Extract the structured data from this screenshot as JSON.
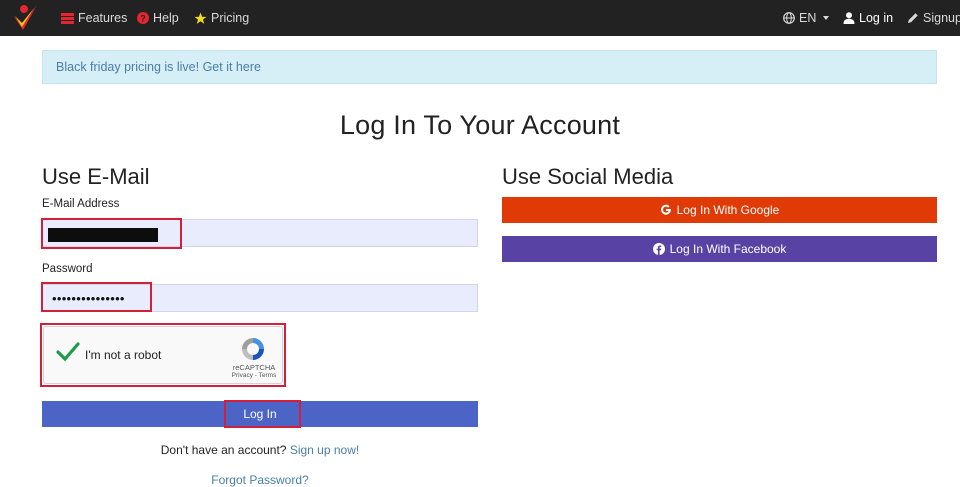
{
  "nav": {
    "left": [
      {
        "label": "Features",
        "icon": "list-icon"
      },
      {
        "label": "Help",
        "icon": "question-circle-icon"
      },
      {
        "label": "Pricing",
        "icon": "star-icon"
      }
    ],
    "language": "EN",
    "login": "Log in",
    "signup": "Signup"
  },
  "alert": {
    "text": "Black friday pricing is live! Get it here"
  },
  "page": {
    "title": "Log In To Your Account"
  },
  "email_section": {
    "heading": "Use E-Mail",
    "email_label": "E-Mail Address",
    "email_value": "",
    "password_label": "Password",
    "password_value": "•••••••••••••••"
  },
  "captcha": {
    "label": "I'm not a robot",
    "brand": "reCAPTCHA",
    "links": "Privacy - Terms"
  },
  "login_button": "Log In",
  "signup_prompt": {
    "text": "Don't have an account?",
    "link": "Sign up now!"
  },
  "forgot": "Forgot Password?",
  "social": {
    "heading": "Use Social Media",
    "google": "Log In With Google",
    "facebook": "Log In With Facebook"
  },
  "colors": {
    "navbar": "#222222",
    "alert_bg": "#d6eef6",
    "link": "#4a7fa6",
    "primary": "#4c64c5",
    "google": "#e03a06",
    "facebook": "#5843a5",
    "annotation": "#d3203a"
  }
}
